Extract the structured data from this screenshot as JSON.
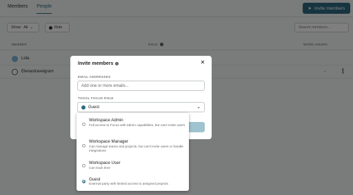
{
  "tabs": [
    {
      "label": "Members"
    },
    {
      "label": "People"
    }
  ],
  "invite_button": {
    "label": "Invite members"
  },
  "filters": {
    "show_label": "Show:",
    "show_value": "All",
    "role_label": "Role"
  },
  "search": {
    "placeholder": "Search members..."
  },
  "columns": {
    "member": "MEMBER",
    "role": "ROLE",
    "work_hours": "WORK HOURS"
  },
  "members": [
    {
      "name": "Lola",
      "hours": ""
    },
    {
      "name": "Elenastravelgram",
      "hours": "-"
    }
  ],
  "modal": {
    "title": "Invite members",
    "email_label": "EMAIL ADDRESSES",
    "email_placeholder": "Add one or more emails...",
    "role_label": "TOGGL FOCUS ROLE",
    "role_value": "Guest"
  },
  "role_options": [
    {
      "title": "Workspace Admin",
      "desc": "Full access to Focus with admin capabilities, but can't invite users",
      "selected": false
    },
    {
      "title": "Workspace Manager",
      "desc": "Can manage teams and projects, but can't invite users or handle integrations",
      "selected": false
    },
    {
      "title": "Workspace User",
      "desc": "Can track time",
      "selected": false
    },
    {
      "title": "Guest",
      "desc": "External party with limited access to assigned projects",
      "selected": true
    }
  ],
  "colors": {
    "accent": "#2f6b80",
    "overlay": "rgba(0,0,0,0.5)"
  }
}
